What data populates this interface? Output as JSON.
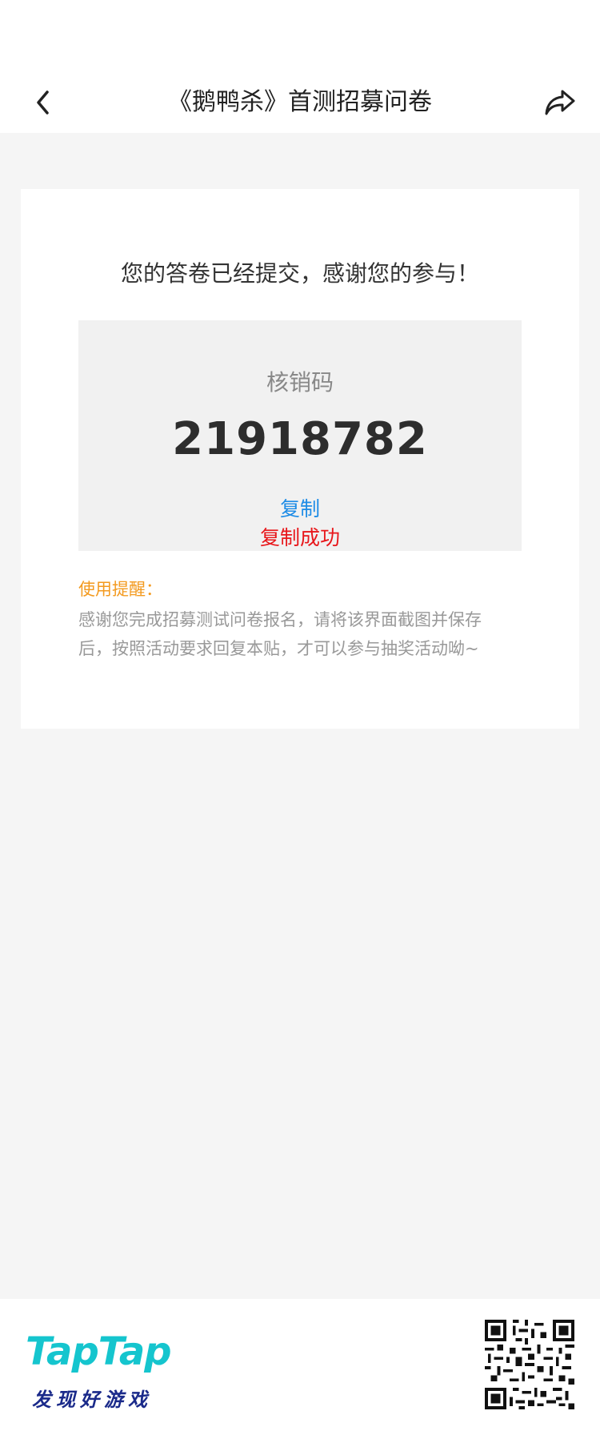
{
  "nav": {
    "title": "《鹅鸭杀》首测招募问卷",
    "back_icon": "chevron-left-icon",
    "share_icon": "share-arrow-icon"
  },
  "card": {
    "submitted_message": "您的答卷已经提交，感谢您的参与！",
    "code_label": "核销码",
    "code_value": "21918782",
    "copy_label": "复制",
    "copy_success": "复制成功",
    "tip_title": "使用提醒：",
    "tip_body": "感谢您完成招募测试问卷报名，请将该界面截图并保存后，按照活动要求回复本贴，才可以参与抽奖活动呦~"
  },
  "footer": {
    "logo_text": "TapTap",
    "slogan": "发现好游戏",
    "qr_icon": "qr-code-icon"
  },
  "colors": {
    "link_blue": "#1e8ce6",
    "success_red": "#e8171b",
    "tip_orange": "#f39a1f",
    "brand_teal": "#15c5ce",
    "brand_navy": "#1a2a8a"
  }
}
